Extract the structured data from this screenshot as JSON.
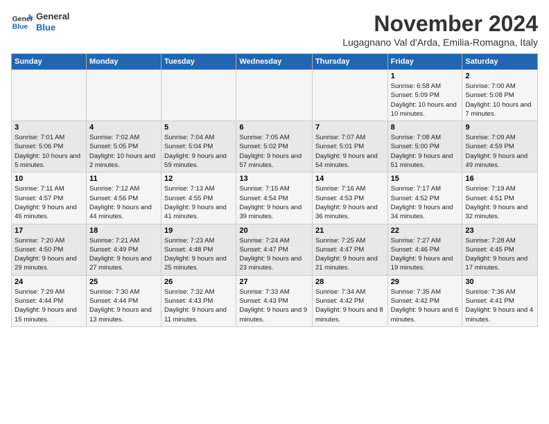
{
  "logo": {
    "line1": "General",
    "line2": "Blue"
  },
  "header": {
    "month_title": "November 2024",
    "location": "Lugagnano Val d'Arda, Emilia-Romagna, Italy"
  },
  "days_of_week": [
    "Sunday",
    "Monday",
    "Tuesday",
    "Wednesday",
    "Thursday",
    "Friday",
    "Saturday"
  ],
  "weeks": [
    [
      {
        "day": "",
        "info": ""
      },
      {
        "day": "",
        "info": ""
      },
      {
        "day": "",
        "info": ""
      },
      {
        "day": "",
        "info": ""
      },
      {
        "day": "",
        "info": ""
      },
      {
        "day": "1",
        "info": "Sunrise: 6:58 AM\nSunset: 5:09 PM\nDaylight: 10 hours and 10 minutes."
      },
      {
        "day": "2",
        "info": "Sunrise: 7:00 AM\nSunset: 5:08 PM\nDaylight: 10 hours and 7 minutes."
      }
    ],
    [
      {
        "day": "3",
        "info": "Sunrise: 7:01 AM\nSunset: 5:06 PM\nDaylight: 10 hours and 5 minutes."
      },
      {
        "day": "4",
        "info": "Sunrise: 7:02 AM\nSunset: 5:05 PM\nDaylight: 10 hours and 2 minutes."
      },
      {
        "day": "5",
        "info": "Sunrise: 7:04 AM\nSunset: 5:04 PM\nDaylight: 9 hours and 59 minutes."
      },
      {
        "day": "6",
        "info": "Sunrise: 7:05 AM\nSunset: 5:02 PM\nDaylight: 9 hours and 57 minutes."
      },
      {
        "day": "7",
        "info": "Sunrise: 7:07 AM\nSunset: 5:01 PM\nDaylight: 9 hours and 54 minutes."
      },
      {
        "day": "8",
        "info": "Sunrise: 7:08 AM\nSunset: 5:00 PM\nDaylight: 9 hours and 51 minutes."
      },
      {
        "day": "9",
        "info": "Sunrise: 7:09 AM\nSunset: 4:59 PM\nDaylight: 9 hours and 49 minutes."
      }
    ],
    [
      {
        "day": "10",
        "info": "Sunrise: 7:11 AM\nSunset: 4:57 PM\nDaylight: 9 hours and 46 minutes."
      },
      {
        "day": "11",
        "info": "Sunrise: 7:12 AM\nSunset: 4:56 PM\nDaylight: 9 hours and 44 minutes."
      },
      {
        "day": "12",
        "info": "Sunrise: 7:13 AM\nSunset: 4:55 PM\nDaylight: 9 hours and 41 minutes."
      },
      {
        "day": "13",
        "info": "Sunrise: 7:15 AM\nSunset: 4:54 PM\nDaylight: 9 hours and 39 minutes."
      },
      {
        "day": "14",
        "info": "Sunrise: 7:16 AM\nSunset: 4:53 PM\nDaylight: 9 hours and 36 minutes."
      },
      {
        "day": "15",
        "info": "Sunrise: 7:17 AM\nSunset: 4:52 PM\nDaylight: 9 hours and 34 minutes."
      },
      {
        "day": "16",
        "info": "Sunrise: 7:19 AM\nSunset: 4:51 PM\nDaylight: 9 hours and 32 minutes."
      }
    ],
    [
      {
        "day": "17",
        "info": "Sunrise: 7:20 AM\nSunset: 4:50 PM\nDaylight: 9 hours and 29 minutes."
      },
      {
        "day": "18",
        "info": "Sunrise: 7:21 AM\nSunset: 4:49 PM\nDaylight: 9 hours and 27 minutes."
      },
      {
        "day": "19",
        "info": "Sunrise: 7:23 AM\nSunset: 4:48 PM\nDaylight: 9 hours and 25 minutes."
      },
      {
        "day": "20",
        "info": "Sunrise: 7:24 AM\nSunset: 4:47 PM\nDaylight: 9 hours and 23 minutes."
      },
      {
        "day": "21",
        "info": "Sunrise: 7:25 AM\nSunset: 4:47 PM\nDaylight: 9 hours and 21 minutes."
      },
      {
        "day": "22",
        "info": "Sunrise: 7:27 AM\nSunset: 4:46 PM\nDaylight: 9 hours and 19 minutes."
      },
      {
        "day": "23",
        "info": "Sunrise: 7:28 AM\nSunset: 4:45 PM\nDaylight: 9 hours and 17 minutes."
      }
    ],
    [
      {
        "day": "24",
        "info": "Sunrise: 7:29 AM\nSunset: 4:44 PM\nDaylight: 9 hours and 15 minutes."
      },
      {
        "day": "25",
        "info": "Sunrise: 7:30 AM\nSunset: 4:44 PM\nDaylight: 9 hours and 13 minutes."
      },
      {
        "day": "26",
        "info": "Sunrise: 7:32 AM\nSunset: 4:43 PM\nDaylight: 9 hours and 11 minutes."
      },
      {
        "day": "27",
        "info": "Sunrise: 7:33 AM\nSunset: 4:43 PM\nDaylight: 9 hours and 9 minutes."
      },
      {
        "day": "28",
        "info": "Sunrise: 7:34 AM\nSunset: 4:42 PM\nDaylight: 9 hours and 8 minutes."
      },
      {
        "day": "29",
        "info": "Sunrise: 7:35 AM\nSunset: 4:42 PM\nDaylight: 9 hours and 6 minutes."
      },
      {
        "day": "30",
        "info": "Sunrise: 7:36 AM\nSunset: 4:41 PM\nDaylight: 9 hours and 4 minutes."
      }
    ]
  ]
}
